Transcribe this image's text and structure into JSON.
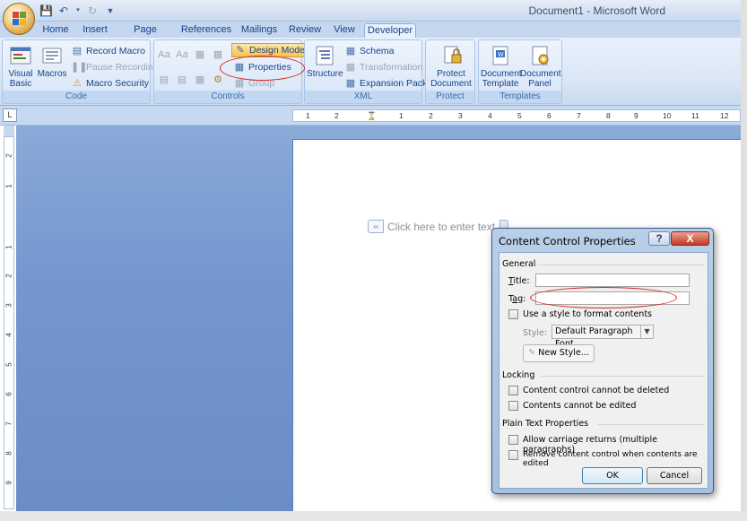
{
  "window": {
    "title": "Document1 - Microsoft Word"
  },
  "quick_access": {
    "icons": [
      "save-icon",
      "undo-icon",
      "redo-icon",
      "customize-icon"
    ]
  },
  "tabs": [
    "Home",
    "Insert",
    "Page Layout",
    "References",
    "Mailings",
    "Review",
    "View",
    "Developer"
  ],
  "active_tab": "Developer",
  "ribbon": {
    "code": {
      "label": "Code",
      "visual_basic": "Visual Basic",
      "macros": "Macros",
      "record_macro": "Record Macro",
      "pause_recording": "Pause Recording",
      "macro_security": "Macro Security"
    },
    "controls": {
      "label": "Controls",
      "design_mode": "Design Mode",
      "properties": "Properties",
      "group": "Group"
    },
    "xml": {
      "label": "XML",
      "structure": "Structure",
      "schema": "Schema",
      "transformation": "Transformation",
      "expansion_packs": "Expansion Packs"
    },
    "protect": {
      "label": "Protect",
      "protect_document": "Protect Document"
    },
    "templates": {
      "label": "Templates",
      "document_template": "Document Template",
      "document_panel": "Document Panel"
    }
  },
  "ruler": {
    "tab_selector": "L",
    "ticks": [
      "1",
      "2",
      "1",
      "1",
      "2",
      "3",
      "4",
      "5",
      "6",
      "7",
      "8",
      "9",
      "10",
      "11",
      "12"
    ],
    "vertical_ticks": [
      "2",
      "1",
      "1",
      "2",
      "3",
      "4",
      "5",
      "6",
      "7",
      "8",
      "9"
    ]
  },
  "document": {
    "content_control_placeholder": "Click here to enter text."
  },
  "dialog": {
    "title": "Content Control Properties",
    "help": "?",
    "close": "X",
    "general": {
      "header": "General",
      "title_label": "Title:",
      "title_value": "",
      "tag_label": "Tag:",
      "tag_value": "",
      "use_style_label": "Use a style to format contents",
      "use_style_checked": false,
      "style_label": "Style:",
      "style_value": "Default Paragraph Font",
      "new_style": "New Style..."
    },
    "locking": {
      "header": "Locking",
      "cannot_delete": "Content control cannot be deleted",
      "cannot_delete_checked": false,
      "cannot_edit": "Contents cannot be edited",
      "cannot_edit_checked": false
    },
    "plain_text": {
      "header": "Plain Text Properties",
      "allow_returns": "Allow carriage returns (multiple paragraphs)",
      "allow_returns_checked": false,
      "remove_control": "Remove content control when contents are edited",
      "remove_control_checked": false
    },
    "ok": "OK",
    "cancel": "Cancel"
  },
  "colors": {
    "ribbon_text": "#15428b",
    "highlight_ellipse": "#d62020",
    "design_mode_active": "#f8c24e",
    "document_background": "#7596cf"
  }
}
